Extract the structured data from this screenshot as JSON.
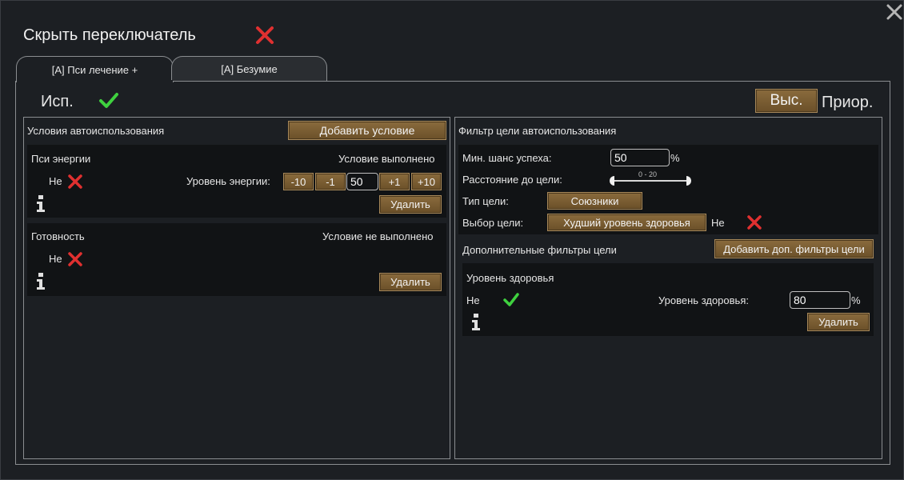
{
  "header": {
    "title": "Скрыть переключатель"
  },
  "tabs": [
    {
      "label": "[A] Пси лечение +"
    },
    {
      "label": "[A] Безумие"
    }
  ],
  "use_label": "Исп.",
  "priority": {
    "button": "Выс.",
    "label": "Приор."
  },
  "left": {
    "title": "Условия автоиспользования",
    "add_button": "Добавить условие",
    "conditions": [
      {
        "name": "Пси энергии",
        "status": "Условие выполнено",
        "not_label": "Не",
        "energy_label": "Уровень энергии:",
        "steps": [
          "-10",
          "-1",
          "+1",
          "+10"
        ],
        "value": "50",
        "delete": "Удалить"
      },
      {
        "name": "Готовность",
        "status": "Условие не выполнено",
        "not_label": "Не",
        "delete": "Удалить"
      }
    ]
  },
  "right": {
    "title": "Фильтр цели автоиспользования",
    "min_chance_label": "Мин. шанс успеха:",
    "min_chance_value": "50",
    "percent": "%",
    "distance_label": "Расстояние до цели:",
    "distance_range": "0 - 20",
    "target_type_label": "Тип цели:",
    "target_type_value": "Союзники",
    "target_select_label": "Выбор цели:",
    "target_select_value": "Худший уровень здоровья",
    "target_select_not": "Не",
    "extra_title": "Дополнительные фильтры цели",
    "extra_add_button": "Добавить доп. фильтры цели",
    "health": {
      "name": "Уровень здоровья",
      "not_label": "Не",
      "level_label": "Уровень здоровья:",
      "value": "80",
      "percent": "%",
      "delete": "Удалить"
    }
  },
  "colors": {
    "accent_button": "#7a5e33",
    "check": "#3fd13f",
    "cross": "#e03030"
  }
}
